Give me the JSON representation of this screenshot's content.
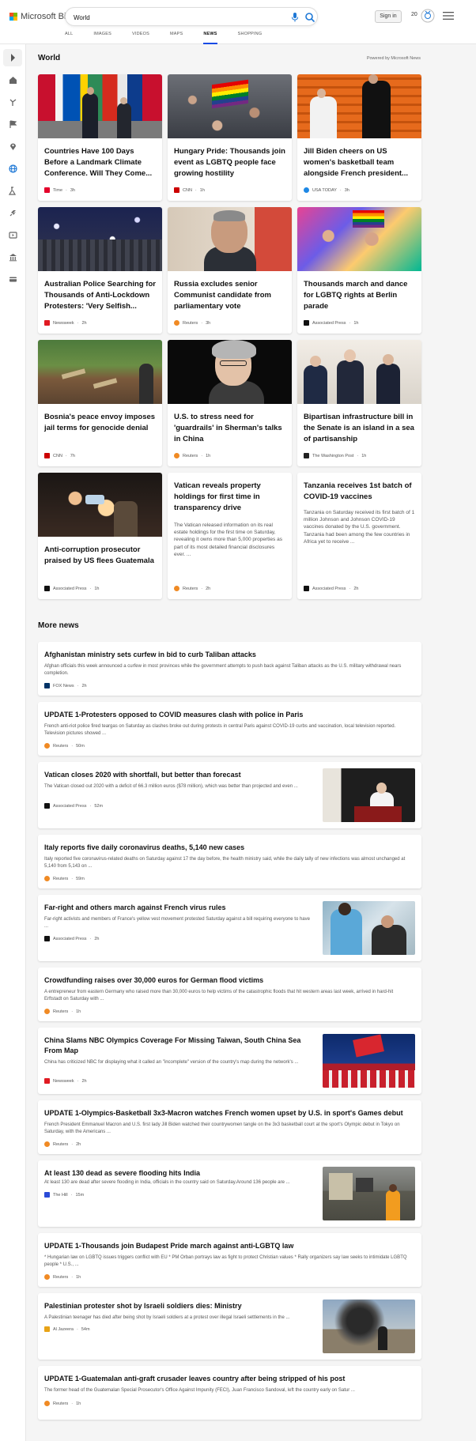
{
  "header": {
    "logo_text": "Microsoft Bing",
    "search_value": "World",
    "signin_label": "Sign in",
    "reward_count": "20"
  },
  "tabs": [
    {
      "label": "ALL"
    },
    {
      "label": "IMAGES"
    },
    {
      "label": "VIDEOS"
    },
    {
      "label": "MAPS"
    },
    {
      "label": "NEWS"
    },
    {
      "label": "SHOPPING"
    }
  ],
  "sidebar": {
    "icons": [
      "expand-icon",
      "home-icon",
      "discover-icon",
      "flag-icon",
      "map-pin-icon",
      "world-icon",
      "science-icon",
      "rocket-icon",
      "video-icon",
      "bank-icon",
      "card-icon"
    ]
  },
  "world": {
    "heading": "World",
    "powered_by": "Powered by Microsoft News",
    "cards": [
      {
        "title": "Countries Have 100 Days Before a Landmark Climate Conference. Will They Come...",
        "source": "Time",
        "age": "3h",
        "logo_color": "#e4002b"
      },
      {
        "title": "Hungary Pride: Thousands join event as LGBTQ people face growing hostility",
        "source": "CNN",
        "age": "1h",
        "logo_color": "#cc0000"
      },
      {
        "title": "Jill Biden cheers on US women's basketball team alongside French president...",
        "source": "USA TODAY",
        "age": "3h",
        "logo_color": "#1e88e5"
      },
      {
        "title": "Australian Police Searching for Thousands of Anti-Lockdown Protesters: 'Very Selfish...",
        "source": "Newsweek",
        "age": "2h",
        "logo_color": "#e01a22"
      },
      {
        "title": "Russia excludes senior Communist candidate from parliamentary vote",
        "source": "Reuters",
        "age": "3h",
        "logo_color": "#f08a24"
      },
      {
        "title": "Thousands march and dance for LGBTQ rights at Berlin parade",
        "source": "Associated Press",
        "age": "1h",
        "logo_color": "#111111"
      },
      {
        "title": "Bosnia's peace envoy imposes jail terms for genocide denial",
        "source": "CNN",
        "age": "7h",
        "logo_color": "#cc0000"
      },
      {
        "title": "U.S. to stress need for 'guardrails' in Sherman's talks in China",
        "source": "Reuters",
        "age": "1h",
        "logo_color": "#f08a24"
      },
      {
        "title": "Bipartisan infrastructure bill in the Senate is an island in a sea of partisanship",
        "source": "The Washington Post",
        "age": "1h",
        "logo_color": "#222222"
      },
      {
        "title": "Anti-corruption prosecutor praised by US flees Guatemala",
        "source": "Associated Press",
        "age": "1h",
        "logo_color": "#111111"
      },
      {
        "title": "Vatican reveals property holdings for first time in transparency drive",
        "snippet": "The Vatican released information on its real estate holdings for the first time on Saturday, revealing it owns more than 5,000 properties as part of its most detailed financial disclosures ever. ...",
        "source": "Reuters",
        "age": "2h",
        "logo_color": "#f08a24"
      },
      {
        "title": "Tanzania receives 1st batch of COVID-19 vaccines",
        "snippet": "Tanzania on Saturday received its first batch of 1 million Johnson and Johnson COVID-19 vaccines donated by the U.S. government. Tanzania had been among the few countries in Africa yet to receive ...",
        "source": "Associated Press",
        "age": "2h",
        "logo_color": "#111111"
      }
    ]
  },
  "more_news": {
    "heading": "More news",
    "items": [
      {
        "title": "Afghanistan ministry sets curfew in bid to curb Taliban attacks",
        "snippet": "Afghan officials this week announced a curfew in most provinces while the government attempts to push back against Taliban attacks as the U.S. military withdrawal nears completion.",
        "source": "FOX News",
        "age": "2h",
        "logo_color": "#003366"
      },
      {
        "title": "UPDATE 1-Protesters opposed to COVID measures clash with police in Paris",
        "snippet": "French anti-riot police fired teargas on Saturday as clashes broke out during protests in central Paris against COVID-19 curbs and vaccination, local television reported. Television pictures showed ...",
        "source": "Reuters",
        "age": "50m",
        "logo_color": "#f08a24"
      },
      {
        "title": "Vatican closes 2020 with shortfall, but better than forecast",
        "snippet": "The Vatican closed out 2020 with a deficit of 66.3 million euros ($78 million), which was better than projected and even ...",
        "source": "Associated Press",
        "age": "52m",
        "logo_color": "#111111"
      },
      {
        "title": "Italy reports five daily coronavirus deaths, 5,140 new cases",
        "snippet": "Italy reported five coronavirus-related deaths on Saturday against 17 the day before, the health ministry said, while the daily tally of new infections was almost unchanged at 5,140 from 5,143 on ...",
        "source": "Reuters",
        "age": "59m",
        "logo_color": "#f08a24"
      },
      {
        "title": "Far-right and others march against French virus rules",
        "snippet": "Far-right activists and members of France's yellow vest movement protested Saturday against a bill requiring everyone to have ...",
        "source": "Associated Press",
        "age": "2h",
        "logo_color": "#111111"
      },
      {
        "title": "Crowdfunding raises over 30,000 euros for German flood victims",
        "snippet": "A entrepreneur from eastern Germany who raised more than 30,000 euros to help victims of the catastrophic floods that hit western areas last week, arrived in hard-hit Erftstadt on Saturday with ...",
        "source": "Reuters",
        "age": "1h",
        "logo_color": "#f08a24"
      },
      {
        "title": "China Slams NBC Olympics Coverage For Missing Taiwan, South China Sea From Map",
        "snippet": "China has criticized NBC for displaying what it called an \"incomplete\" version of the country's map during the network's ...",
        "source": "Newsweek",
        "age": "2h",
        "logo_color": "#e01a22"
      },
      {
        "title": "UPDATE 1-Olympics-Basketball 3x3-Macron watches French women upset by U.S. in sport's Games debut",
        "snippet": "French President Emmanuel Macron and U.S. first lady Jill Biden watched their countrywomen tangle on the 3x3 basketball court at the sport's Olympic debut in Tokyo on Saturday, with the Americans ...",
        "source": "Reuters",
        "age": "2h",
        "logo_color": "#f08a24"
      },
      {
        "title": "At least 130 dead as severe flooding hits India",
        "snippet": "At least 130 are dead after severe flooding in India, officials in the country said on Saturday.Around 136 people are ...",
        "source": "The Hill",
        "age": "15m",
        "logo_color": "#2a4bd7"
      },
      {
        "title": "UPDATE 1-Thousands join Budapest Pride march against anti-LGBTQ law",
        "snippet": "* Hungarian law on LGBTQ issues triggers conflict with EU * PM Orban portrays law as fight to protect Christian values * Rally organizers say law seeks to intimidate LGBTQ people * U.S., ...",
        "source": "Reuters",
        "age": "1h",
        "logo_color": "#f08a24"
      },
      {
        "title": "Palestinian protester shot by Israeli soldiers dies: Ministry",
        "snippet": "A Palestinian teenager has died after being shot by Israeli soldiers at a protest over illegal Israeli settlements in the ...",
        "source": "Al Jazeera",
        "age": "54m",
        "logo_color": "#e8a317"
      },
      {
        "title": "UPDATE 1-Guatemalan anti-graft crusader leaves country after being stripped of his post",
        "snippet": "The former head of the Guatemalan Special Prosecutor's Office Against Impunity (FECI), Juan Francisco Sandoval, left the country early on Satur ...",
        "source": "Reuters",
        "age": "1h",
        "logo_color": "#f08a24"
      }
    ]
  }
}
